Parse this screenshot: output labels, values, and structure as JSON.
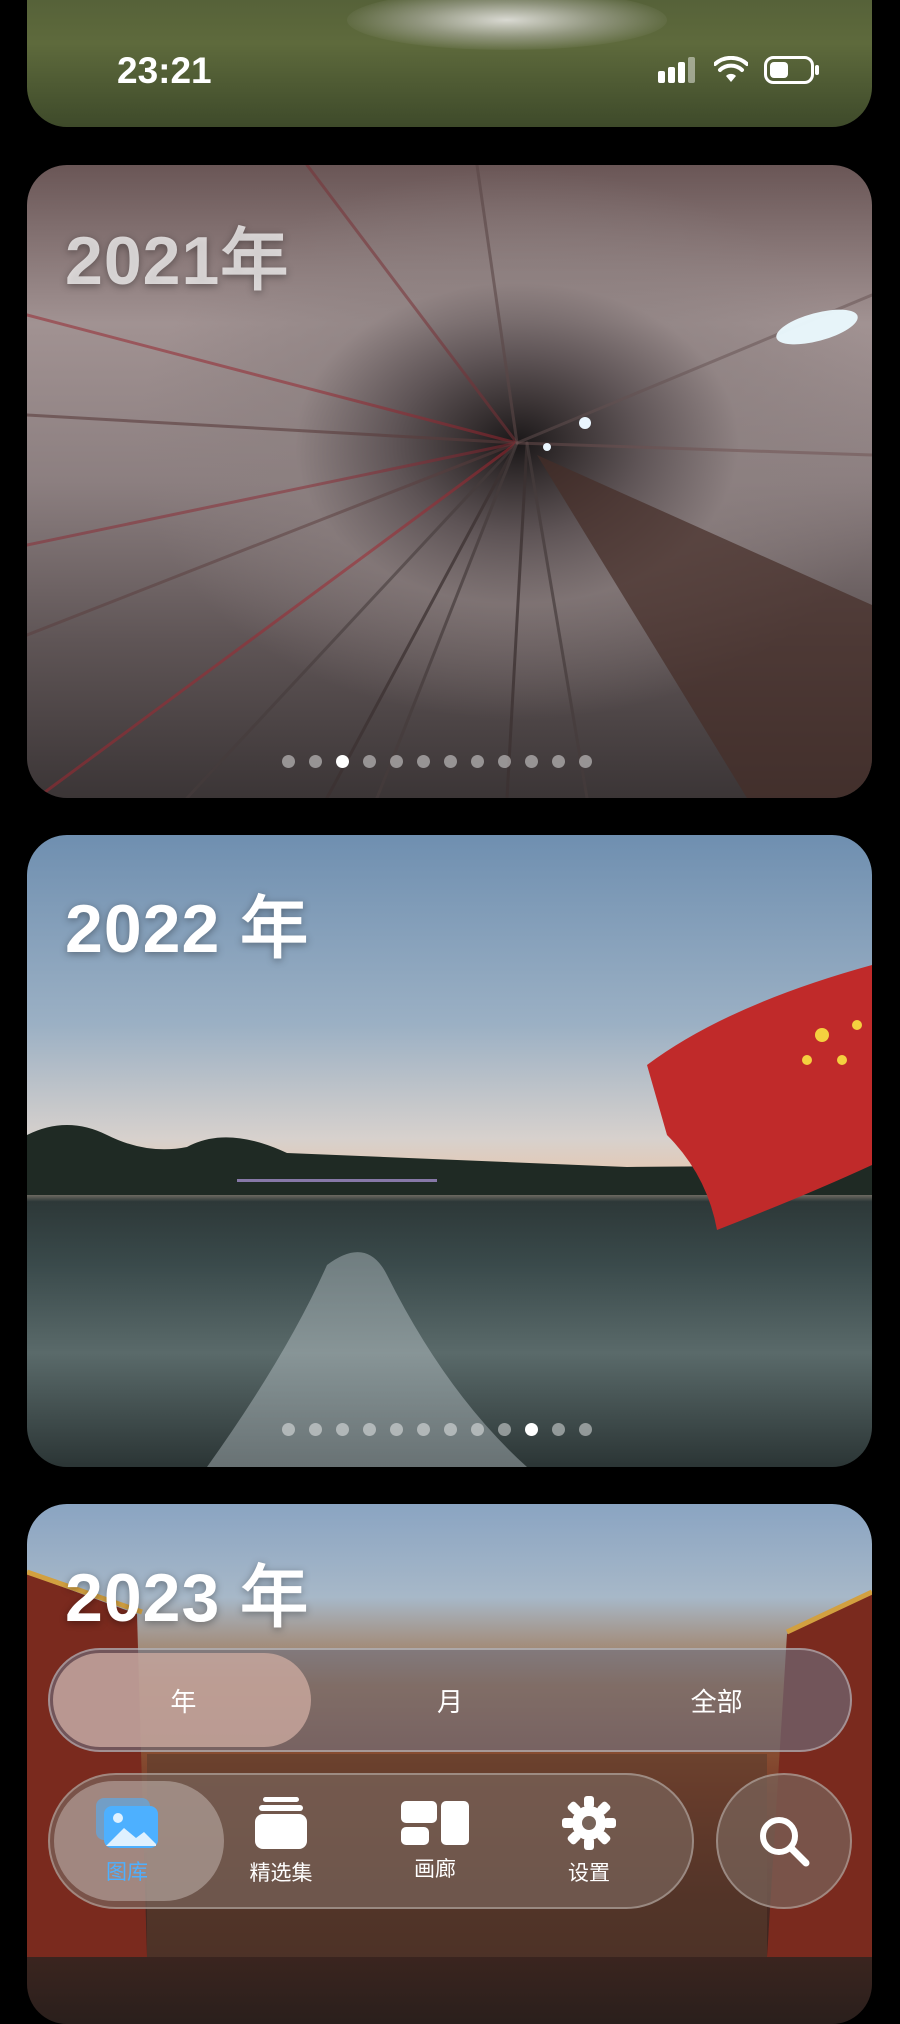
{
  "status_bar": {
    "time": "23:21"
  },
  "cards": [
    {
      "year_label": "2021年",
      "page_count": 12,
      "active_page": 3
    },
    {
      "year_label": "2022 年",
      "page_count": 12,
      "active_page": 10
    },
    {
      "year_label": "2023 年"
    }
  ],
  "view_switch": {
    "options": [
      "年",
      "月",
      "全部"
    ],
    "selected": "年"
  },
  "tabbar": {
    "items": [
      {
        "label": "图库",
        "icon": "photo-library-icon",
        "active": true
      },
      {
        "label": "精选集",
        "icon": "collections-icon",
        "active": false
      },
      {
        "label": "画廊",
        "icon": "gallery-icon",
        "active": false
      },
      {
        "label": "设置",
        "icon": "gear-icon",
        "active": false
      }
    ],
    "active_color": "#4db0ff"
  },
  "search": {
    "icon": "search-icon"
  }
}
